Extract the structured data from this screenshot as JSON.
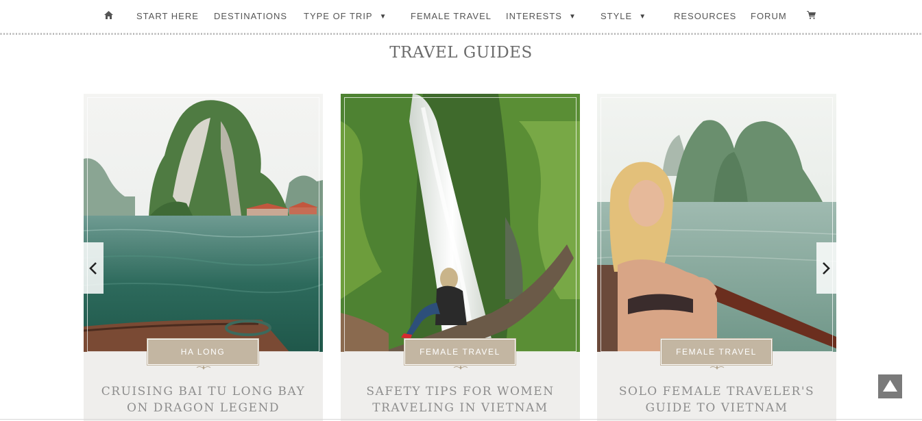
{
  "nav": {
    "home_icon": "home-icon",
    "items": [
      {
        "label": "START HERE",
        "dropdown": false
      },
      {
        "label": "DESTINATIONS",
        "dropdown": false
      },
      {
        "label": "TYPE OF TRIP",
        "dropdown": true
      },
      {
        "label": "FEMALE TRAVEL",
        "dropdown": false
      },
      {
        "label": "INTERESTS",
        "dropdown": true
      },
      {
        "label": "STYLE",
        "dropdown": true
      },
      {
        "label": "RESOURCES",
        "dropdown": false
      },
      {
        "label": "FORUM",
        "dropdown": false
      }
    ],
    "cart_icon": "cart-icon",
    "caret_glyph": "▼"
  },
  "section": {
    "title": "TRAVEL GUIDES"
  },
  "cards": [
    {
      "category": "HA LONG",
      "title": "CRUISING BAI TU LONG BAY ON DRAGON LEGEND",
      "image": "ha-long-bay-boat-photo"
    },
    {
      "category": "FEMALE TRAVEL",
      "title": "SAFETY TIPS FOR WOMEN TRAVELING IN VIETNAM",
      "image": "waterfall-woman-photo"
    },
    {
      "category": "FEMALE TRAVEL",
      "title": "SOLO FEMALE TRAVELER'S GUIDE TO VIETNAM",
      "image": "woman-on-boat-photo"
    }
  ],
  "carousel": {
    "prev_icon": "chevron-left-icon",
    "next_icon": "chevron-right-icon"
  },
  "back_to_top_icon": "triangle-up-icon",
  "colors": {
    "badge": "#c3b6a2",
    "card_bg": "#efeeec",
    "nav_text": "#555555",
    "title_text": "#8d8d8d"
  }
}
